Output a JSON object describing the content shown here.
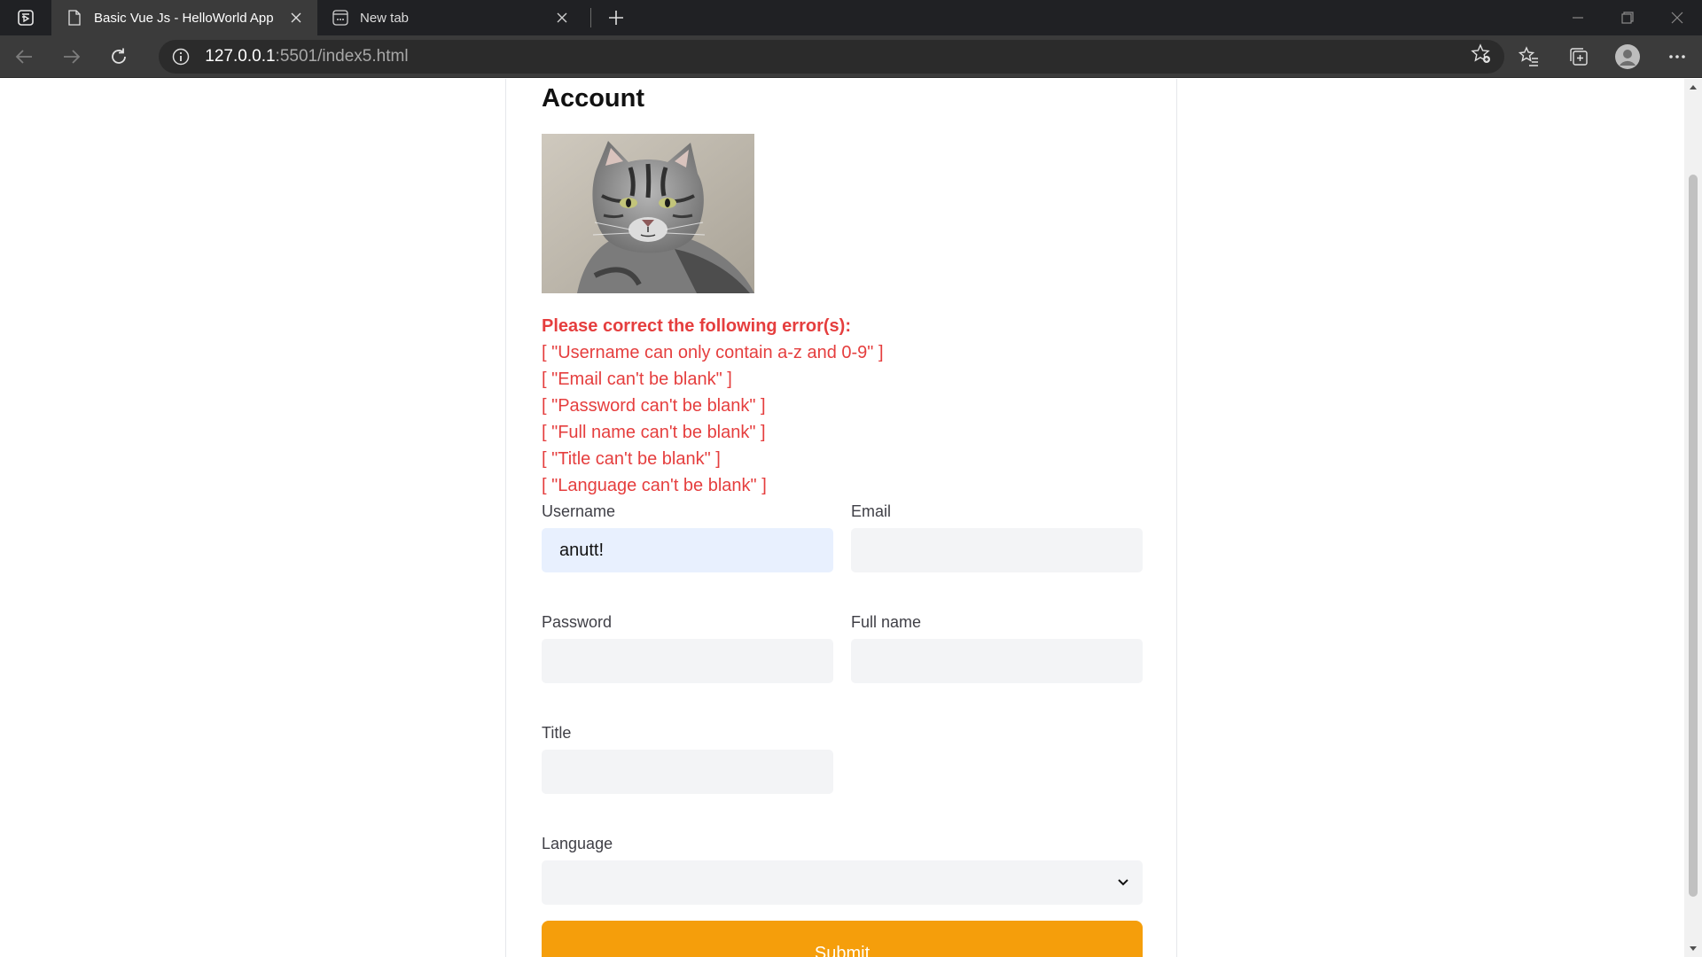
{
  "browser": {
    "tabs": [
      {
        "title": "Basic Vue Js - HelloWorld App",
        "active": true
      },
      {
        "title": "New tab",
        "active": false
      }
    ],
    "url_host": "127.0.0.1",
    "url_path": ":5501/index5.html"
  },
  "page": {
    "title": "Account",
    "errors_heading": "Please correct the following error(s):",
    "errors": [
      "[ \"Username can only contain a-z and 0-9\" ]",
      "[ \"Email can't be blank\" ]",
      "[ \"Password can't be blank\" ]",
      "[ \"Full name can't be blank\" ]",
      "[ \"Title can't be blank\" ]",
      "[ \"Language can't be blank\" ]"
    ],
    "form": {
      "username_label": "Username",
      "username_value": "anutt!",
      "email_label": "Email",
      "email_value": "",
      "password_label": "Password",
      "password_value": "",
      "fullname_label": "Full name",
      "fullname_value": "",
      "title_label": "Title",
      "title_value": "",
      "language_label": "Language",
      "language_value": "",
      "submit_label": "Submit"
    }
  },
  "colors": {
    "error": "#e53e3e",
    "submit": "#f59e0b",
    "input_bg": "#f3f4f6",
    "autofill_bg": "#e8f0fe"
  }
}
